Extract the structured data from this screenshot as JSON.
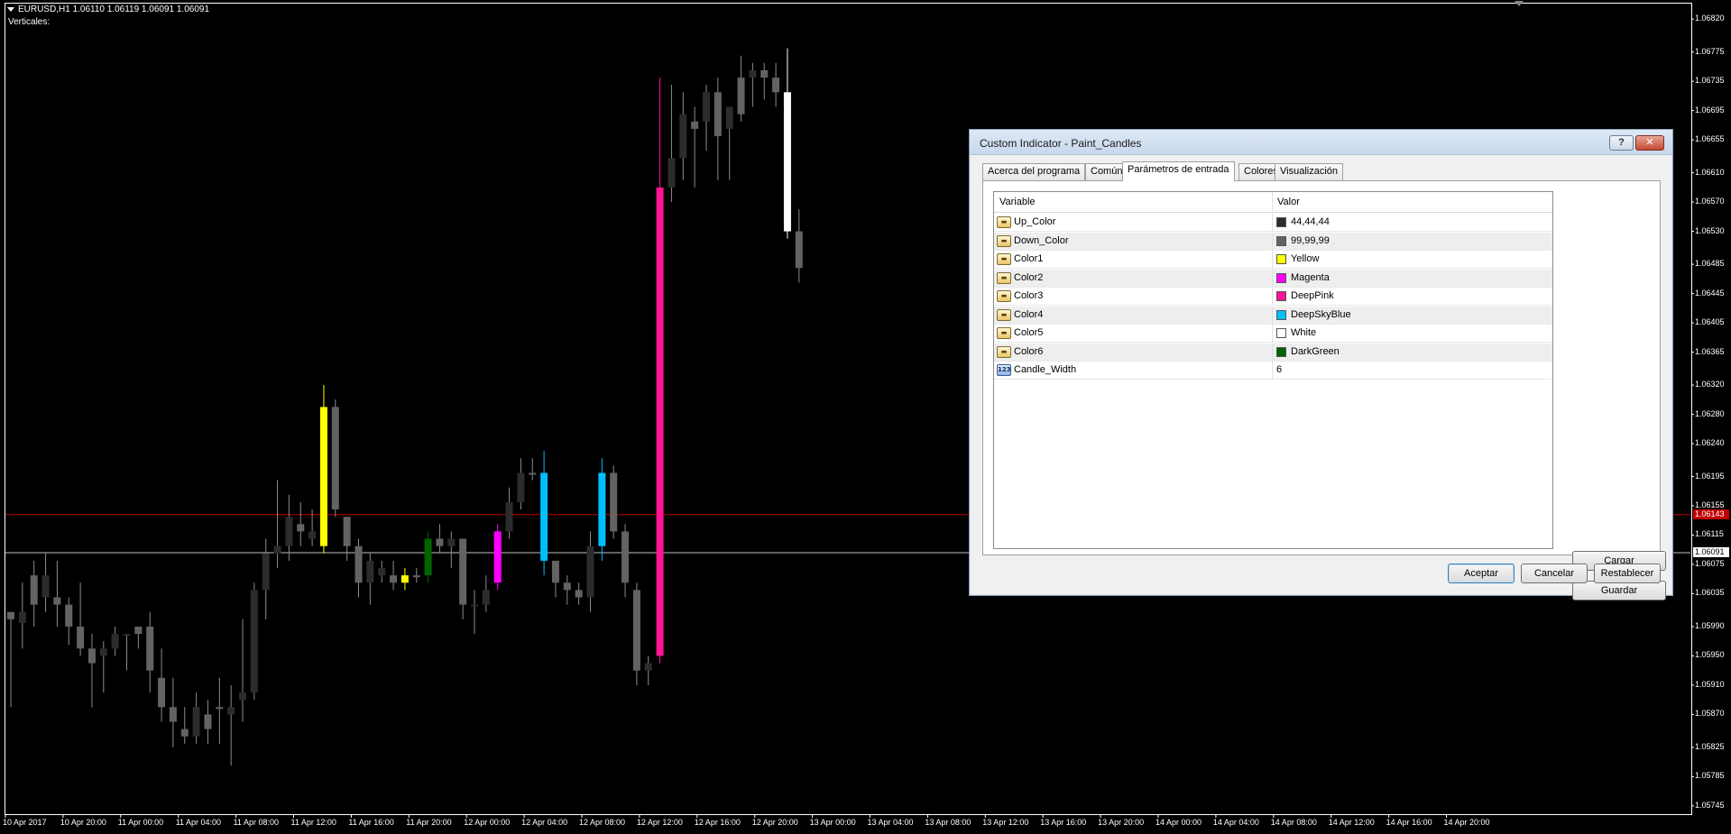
{
  "chart": {
    "title": "EURUSD,H1  1.06110 1.06119 1.06091 1.06091",
    "subtitle": "Verticales:",
    "price_labels": [
      "1.06820",
      "1.06775",
      "1.06735",
      "1.06695",
      "1.06655",
      "1.06610",
      "1.06570",
      "1.06530",
      "1.06485",
      "1.06445",
      "1.06405",
      "1.06365",
      "1.06320",
      "1.06280",
      "1.06240",
      "1.06195",
      "1.06155",
      "1.06115",
      "1.06075",
      "1.06035",
      "1.05990",
      "1.05950",
      "1.05910",
      "1.05870",
      "1.05825",
      "1.05785",
      "1.05745"
    ],
    "bid_tag": "1.06091",
    "red_line_tag": "1.06143",
    "time_labels": [
      "10 Apr 2017",
      "10 Apr 20:00",
      "11 Apr 00:00",
      "11 Apr 04:00",
      "11 Apr 08:00",
      "11 Apr 12:00",
      "11 Apr 16:00",
      "11 Apr 20:00",
      "12 Apr 00:00",
      "12 Apr 04:00",
      "12 Apr 08:00",
      "12 Apr 12:00",
      "12 Apr 16:00",
      "12 Apr 20:00",
      "13 Apr 00:00",
      "13 Apr 04:00",
      "13 Apr 08:00",
      "13 Apr 12:00",
      "13 Apr 16:00",
      "13 Apr 20:00",
      "14 Apr 00:00",
      "14 Apr 04:00",
      "14 Apr 08:00",
      "14 Apr 12:00",
      "14 Apr 16:00",
      "14 Apr 20:00"
    ],
    "colors": {
      "up": "#2c2c2c",
      "down": "#636363",
      "wick": "#8c8c8c",
      "red_line": "#c00000",
      "bid_line": "#c0c0c0"
    }
  },
  "chart_data": {
    "type": "candlestick",
    "symbol": "EURUSD",
    "timeframe": "H1",
    "ylim": [
      1.05735,
      1.0683
    ],
    "candles": [
      {
        "o": 1.0601,
        "h": 1.0601,
        "l": 1.0588,
        "c": 1.06,
        "color": "down"
      },
      {
        "o": 1.05995,
        "h": 1.0605,
        "l": 1.0596,
        "c": 1.0601,
        "color": "up"
      },
      {
        "o": 1.0606,
        "h": 1.0608,
        "l": 1.0599,
        "c": 1.0602,
        "color": "down"
      },
      {
        "o": 1.0606,
        "h": 1.0609,
        "l": 1.0601,
        "c": 1.0603,
        "color": "up"
      },
      {
        "o": 1.0603,
        "h": 1.0608,
        "l": 1.0599,
        "c": 1.0602,
        "color": "down"
      },
      {
        "o": 1.0602,
        "h": 1.0603,
        "l": 1.05965,
        "c": 1.0599,
        "color": "down"
      },
      {
        "o": 1.0599,
        "h": 1.0605,
        "l": 1.0595,
        "c": 1.0596,
        "color": "down"
      },
      {
        "o": 1.0596,
        "h": 1.0598,
        "l": 1.0588,
        "c": 1.0594,
        "color": "down"
      },
      {
        "o": 1.0595,
        "h": 1.0597,
        "l": 1.059,
        "c": 1.0596,
        "color": "up"
      },
      {
        "o": 1.0596,
        "h": 1.0599,
        "l": 1.0595,
        "c": 1.0598,
        "color": "up"
      },
      {
        "o": 1.0598,
        "h": 1.0598,
        "l": 1.0593,
        "c": 1.0598,
        "color": "up"
      },
      {
        "o": 1.0599,
        "h": 1.0599,
        "l": 1.0596,
        "c": 1.0598,
        "color": "down"
      },
      {
        "o": 1.0599,
        "h": 1.0601,
        "l": 1.059,
        "c": 1.0593,
        "color": "down"
      },
      {
        "o": 1.0592,
        "h": 1.0596,
        "l": 1.0586,
        "c": 1.0588,
        "color": "down"
      },
      {
        "o": 1.0588,
        "h": 1.0592,
        "l": 1.05825,
        "c": 1.0586,
        "color": "down"
      },
      {
        "o": 1.0585,
        "h": 1.0588,
        "l": 1.0583,
        "c": 1.0584,
        "color": "down"
      },
      {
        "o": 1.0584,
        "h": 1.059,
        "l": 1.0583,
        "c": 1.0588,
        "color": "up"
      },
      {
        "o": 1.0585,
        "h": 1.0589,
        "l": 1.0583,
        "c": 1.0587,
        "color": "down"
      },
      {
        "o": 1.0588,
        "h": 1.0592,
        "l": 1.0583,
        "c": 1.0588,
        "color": "down"
      },
      {
        "o": 1.0587,
        "h": 1.0591,
        "l": 1.058,
        "c": 1.0588,
        "color": "up"
      },
      {
        "o": 1.0589,
        "h": 1.06,
        "l": 1.0586,
        "c": 1.059,
        "color": "up"
      },
      {
        "o": 1.059,
        "h": 1.0605,
        "l": 1.0589,
        "c": 1.0604,
        "color": "up"
      },
      {
        "o": 1.0604,
        "h": 1.0611,
        "l": 1.06,
        "c": 1.0609,
        "color": "up"
      },
      {
        "o": 1.0609,
        "h": 1.0619,
        "l": 1.0607,
        "c": 1.061,
        "color": "up"
      },
      {
        "o": 1.061,
        "h": 1.0617,
        "l": 1.0608,
        "c": 1.0614,
        "color": "up"
      },
      {
        "o": 1.0613,
        "h": 1.0616,
        "l": 1.061,
        "c": 1.0612,
        "color": "down"
      },
      {
        "o": 1.0611,
        "h": 1.0615,
        "l": 1.061,
        "c": 1.0612,
        "color": "up"
      },
      {
        "o": 1.061,
        "h": 1.0632,
        "l": 1.0609,
        "c": 1.0629,
        "color": "Yellow"
      },
      {
        "o": 1.0629,
        "h": 1.063,
        "l": 1.0614,
        "c": 1.0615,
        "color": "down"
      },
      {
        "o": 1.0614,
        "h": 1.0614,
        "l": 1.0608,
        "c": 1.061,
        "color": "down"
      },
      {
        "o": 1.061,
        "h": 1.0611,
        "l": 1.0603,
        "c": 1.0605,
        "color": "down"
      },
      {
        "o": 1.0605,
        "h": 1.0609,
        "l": 1.0602,
        "c": 1.0608,
        "color": "up"
      },
      {
        "o": 1.0607,
        "h": 1.0608,
        "l": 1.0605,
        "c": 1.0606,
        "color": "up"
      },
      {
        "o": 1.0606,
        "h": 1.0608,
        "l": 1.0604,
        "c": 1.0605,
        "color": "down"
      },
      {
        "o": 1.0605,
        "h": 1.0607,
        "l": 1.0604,
        "c": 1.0606,
        "color": "Yellow"
      },
      {
        "o": 1.0606,
        "h": 1.0607,
        "l": 1.0605,
        "c": 1.0606,
        "color": "down"
      },
      {
        "o": 1.0606,
        "h": 1.0612,
        "l": 1.0605,
        "c": 1.0611,
        "color": "DarkGreen"
      },
      {
        "o": 1.0611,
        "h": 1.0613,
        "l": 1.0609,
        "c": 1.061,
        "color": "down"
      },
      {
        "o": 1.061,
        "h": 1.0612,
        "l": 1.0607,
        "c": 1.0611,
        "color": "up"
      },
      {
        "o": 1.0611,
        "h": 1.0611,
        "l": 1.06,
        "c": 1.0602,
        "color": "down"
      },
      {
        "o": 1.0602,
        "h": 1.0604,
        "l": 1.0598,
        "c": 1.0602,
        "color": "up"
      },
      {
        "o": 1.0602,
        "h": 1.0606,
        "l": 1.0601,
        "c": 1.0604,
        "color": "up"
      },
      {
        "o": 1.0605,
        "h": 1.0613,
        "l": 1.0604,
        "c": 1.0612,
        "color": "Magenta"
      },
      {
        "o": 1.0612,
        "h": 1.0618,
        "l": 1.0611,
        "c": 1.0616,
        "color": "up"
      },
      {
        "o": 1.0616,
        "h": 1.0622,
        "l": 1.0615,
        "c": 1.062,
        "color": "up"
      },
      {
        "o": 1.062,
        "h": 1.0622,
        "l": 1.0619,
        "c": 1.062,
        "color": "down"
      },
      {
        "o": 1.0608,
        "h": 1.0623,
        "l": 1.0606,
        "c": 1.062,
        "color": "DeepSkyBlue"
      },
      {
        "o": 1.0608,
        "h": 1.0608,
        "l": 1.0603,
        "c": 1.0605,
        "color": "down"
      },
      {
        "o": 1.0605,
        "h": 1.0606,
        "l": 1.0602,
        "c": 1.0604,
        "color": "down"
      },
      {
        "o": 1.0604,
        "h": 1.0605,
        "l": 1.0602,
        "c": 1.0603,
        "color": "down"
      },
      {
        "o": 1.0603,
        "h": 1.0612,
        "l": 1.0601,
        "c": 1.061,
        "color": "up"
      },
      {
        "o": 1.061,
        "h": 1.0622,
        "l": 1.0608,
        "c": 1.062,
        "color": "DeepSkyBlue"
      },
      {
        "o": 1.062,
        "h": 1.0621,
        "l": 1.0611,
        "c": 1.0612,
        "color": "down"
      },
      {
        "o": 1.0612,
        "h": 1.0613,
        "l": 1.0603,
        "c": 1.0605,
        "color": "down"
      },
      {
        "o": 1.0604,
        "h": 1.0605,
        "l": 1.0591,
        "c": 1.0593,
        "color": "down"
      },
      {
        "o": 1.0593,
        "h": 1.0595,
        "l": 1.0591,
        "c": 1.0594,
        "color": "up"
      },
      {
        "o": 1.0595,
        "h": 1.0674,
        "l": 1.0594,
        "c": 1.0659,
        "color": "DeepPink"
      },
      {
        "o": 1.0659,
        "h": 1.0673,
        "l": 1.0657,
        "c": 1.0663,
        "color": "up"
      },
      {
        "o": 1.0663,
        "h": 1.0672,
        "l": 1.066,
        "c": 1.0669,
        "color": "up"
      },
      {
        "o": 1.0667,
        "h": 1.067,
        "l": 1.0659,
        "c": 1.0668,
        "color": "down"
      },
      {
        "o": 1.0668,
        "h": 1.0673,
        "l": 1.0664,
        "c": 1.0672,
        "color": "up"
      },
      {
        "o": 1.0672,
        "h": 1.0674,
        "l": 1.066,
        "c": 1.0666,
        "color": "down"
      },
      {
        "o": 1.0667,
        "h": 1.067,
        "l": 1.066,
        "c": 1.067,
        "color": "up"
      },
      {
        "o": 1.0669,
        "h": 1.0677,
        "l": 1.0668,
        "c": 1.0674,
        "color": "down"
      },
      {
        "o": 1.0674,
        "h": 1.0676,
        "l": 1.067,
        "c": 1.0675,
        "color": "up"
      },
      {
        "o": 1.0675,
        "h": 1.0676,
        "l": 1.0671,
        "c": 1.0674,
        "color": "down"
      },
      {
        "o": 1.0674,
        "h": 1.0676,
        "l": 1.067,
        "c": 1.0672,
        "color": "down"
      },
      {
        "o": 1.0672,
        "h": 1.0678,
        "l": 1.0652,
        "c": 1.0653,
        "color": "White"
      },
      {
        "o": 1.0653,
        "h": 1.0656,
        "l": 1.0646,
        "c": 1.0648,
        "color": "down"
      }
    ]
  },
  "dialog": {
    "title": "Custom Indicator - Paint_Candles",
    "help_label": "?",
    "close_label": "✕",
    "tabs": [
      "Acerca del programa",
      "Común",
      "Parámetros de entrada",
      "Colores",
      "Visualización"
    ],
    "active_tab": 2,
    "grid_headers": {
      "variable": "Variable",
      "value": "Valor"
    },
    "params": [
      {
        "name": "Up_Color",
        "value": "44,44,44",
        "swatch": "#2c2c2c",
        "kind": "color"
      },
      {
        "name": "Down_Color",
        "value": "99,99,99",
        "swatch": "#636363",
        "kind": "color"
      },
      {
        "name": "Color1",
        "value": "Yellow",
        "swatch": "#ffff00",
        "kind": "color"
      },
      {
        "name": "Color2",
        "value": "Magenta",
        "swatch": "#ff00ff",
        "kind": "color"
      },
      {
        "name": "Color3",
        "value": "DeepPink",
        "swatch": "#ff1493",
        "kind": "color"
      },
      {
        "name": "Color4",
        "value": "DeepSkyBlue",
        "swatch": "#00bfff",
        "kind": "color"
      },
      {
        "name": "Color5",
        "value": "White",
        "swatch": "#ffffff",
        "kind": "color"
      },
      {
        "name": "Color6",
        "value": "DarkGreen",
        "swatch": "#006400",
        "kind": "color"
      },
      {
        "name": "Candle_Width",
        "value": "6",
        "swatch": null,
        "kind": "int"
      }
    ],
    "buttons": {
      "load": "Cargar",
      "save": "Guardar",
      "ok": "Aceptar",
      "cancel": "Cancelar",
      "reset": "Restablecer"
    }
  }
}
